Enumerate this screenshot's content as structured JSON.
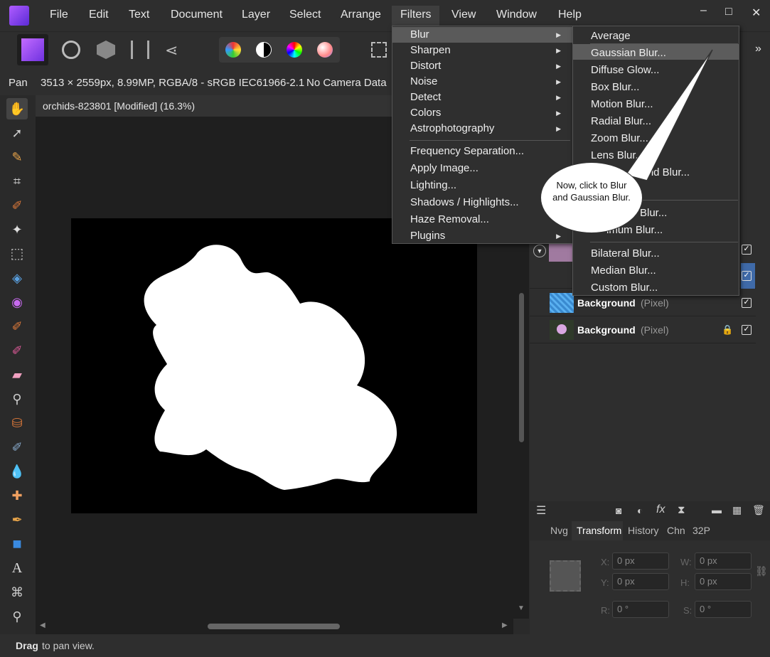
{
  "menubar": {
    "items": [
      "File",
      "Edit",
      "Text",
      "Document",
      "Layer",
      "Select",
      "Arrange",
      "Filters",
      "View",
      "Window",
      "Help"
    ],
    "window_controls": [
      "–",
      "□",
      "✕"
    ]
  },
  "context": {
    "tool": "Pan",
    "image_info": "3513 × 2559px, 8.99MP, RGBA/8 - sRGB IEC61966-2.1",
    "camera": "No Camera Data"
  },
  "document": {
    "tab_title": "orchids-823801 [Modified] (16.3%)"
  },
  "filters_menu": {
    "items": [
      {
        "label": "Blur",
        "submenu": true
      },
      {
        "label": "Sharpen",
        "submenu": true
      },
      {
        "label": "Distort",
        "submenu": true
      },
      {
        "label": "Noise",
        "submenu": true
      },
      {
        "label": "Detect",
        "submenu": true
      },
      {
        "label": "Colors",
        "submenu": true
      },
      {
        "label": "Astrophotography",
        "submenu": true
      },
      {
        "label": "Frequency Separation...",
        "submenu": false
      },
      {
        "label": "Apply Image...",
        "submenu": false
      },
      {
        "label": "Lighting...",
        "submenu": false
      },
      {
        "label": "Shadows / Highlights...",
        "submenu": false
      },
      {
        "label": "Haze Removal...",
        "submenu": false
      },
      {
        "label": "Plugins",
        "submenu": true
      }
    ]
  },
  "blur_menu": {
    "items": [
      "Average",
      "Gaussian Blur...",
      "Diffuse Glow...",
      "Box Blur...",
      "Motion Blur...",
      "Radial Blur...",
      "Zoom Blur...",
      "Lens Blur...",
      "Field Blur...",
      "Blur...",
      "imum Blur...",
      "Bilateral Blur...",
      "Median Blur...",
      "Custom Blur..."
    ]
  },
  "callout": {
    "text": "Now, click to Blur and Gaussian Blur."
  },
  "layers": [
    {
      "name": "Background",
      "type": "(Pixel)"
    },
    {
      "name": "Background",
      "type": "(Pixel)"
    }
  ],
  "panel_tabs": [
    "Nvg",
    "Transform",
    "History",
    "Chn",
    "32P"
  ],
  "transform": {
    "x_label": "X:",
    "x": "0 px",
    "y_label": "Y:",
    "y": "0 px",
    "w_label": "W:",
    "w": "0 px",
    "h_label": "H:",
    "h": "0 px",
    "r_label": "R:",
    "r": "0 °",
    "s_label": "S:",
    "s": "0 °"
  },
  "status": {
    "bold": "Drag",
    "rest": " to pan view."
  },
  "colors": {
    "accent": "#7a3cf0",
    "highlight": "#5a5a5a",
    "selected_layer": "#3f6aa8"
  }
}
